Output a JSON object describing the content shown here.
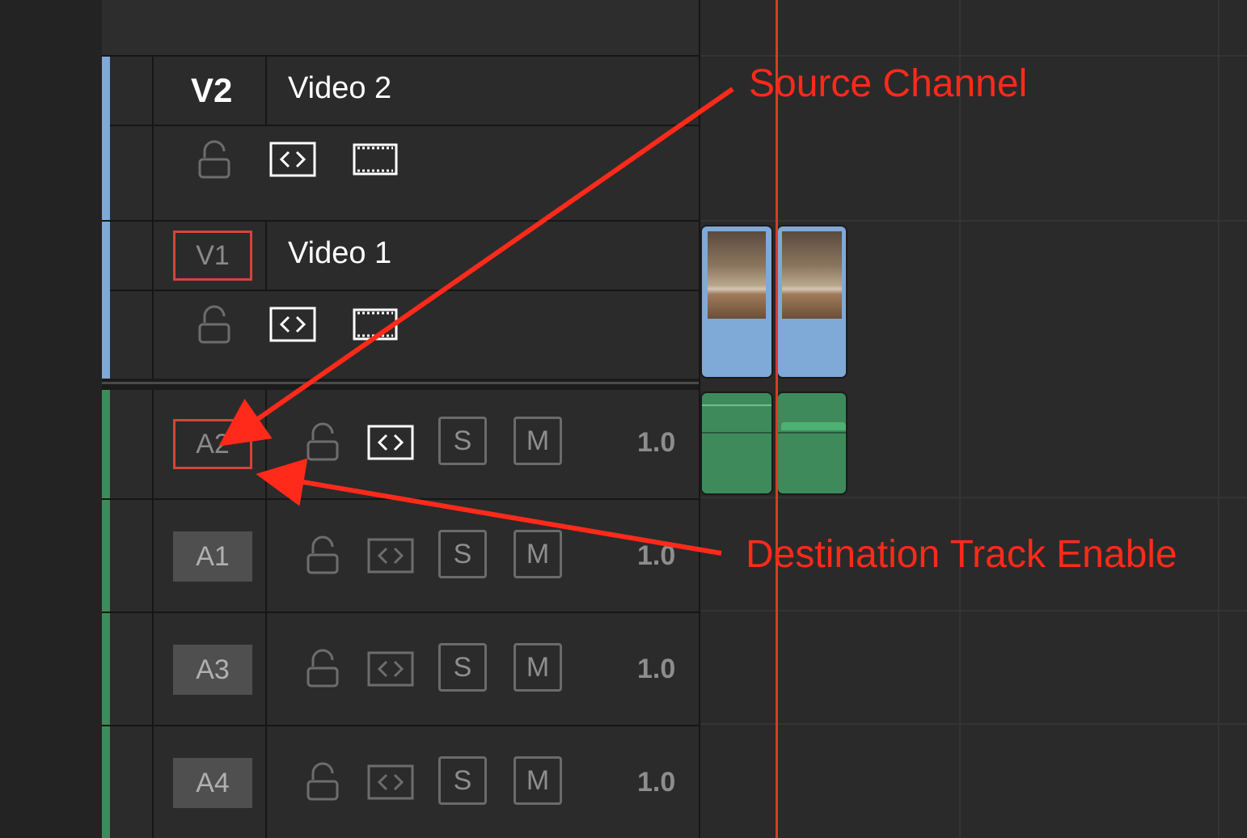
{
  "tracks": {
    "video": [
      {
        "id": "V2",
        "name": "Video 2"
      },
      {
        "id": "V1",
        "name": "Video 1"
      }
    ],
    "audio": [
      {
        "id": "A2",
        "volume": "1.0"
      },
      {
        "id": "A1",
        "volume": "1.0"
      },
      {
        "id": "A3",
        "volume": "1.0"
      },
      {
        "id": "A4",
        "volume": "1.0"
      }
    ],
    "solo_label": "S",
    "mute_label": "M"
  },
  "annotations": {
    "source_channel": "Source Channel",
    "destination_track_enable": "Destination Track Enable"
  },
  "colors": {
    "video_track": "#7fa9d6",
    "audio_track": "#3f8a5b",
    "playhead": "#d93a2b",
    "annotation": "#ff2a1a"
  },
  "icons": [
    "lock-icon",
    "auto-select-icon",
    "track-enable-icon"
  ]
}
